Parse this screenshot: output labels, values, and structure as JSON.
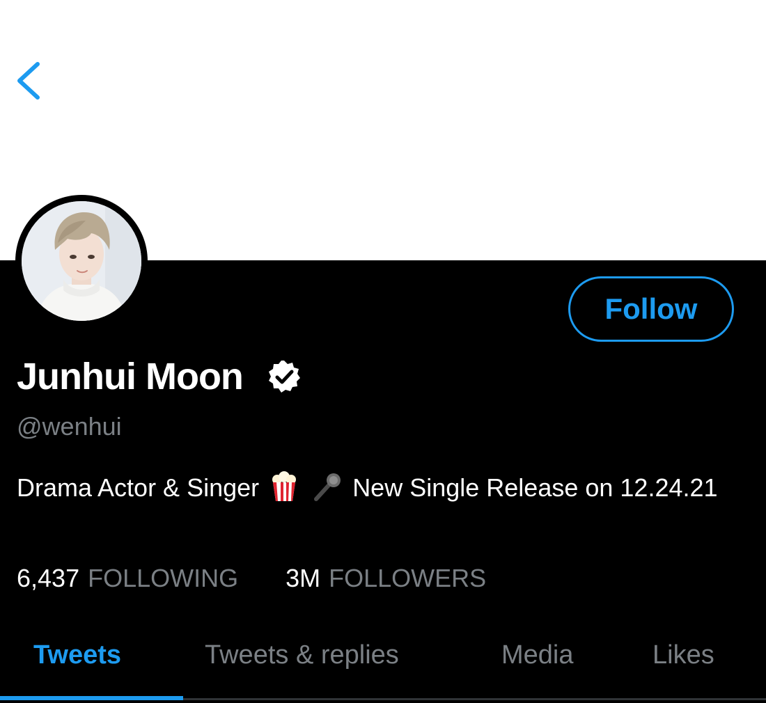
{
  "header": {
    "back_icon": "chevron-left-icon"
  },
  "profile": {
    "display_name": "Junhui Moon",
    "verified_icon": "verified-badge-icon",
    "handle": "@wenhui",
    "bio_before": "Drama Actor & Singer",
    "bio_emoji_1": "popcorn-emoji",
    "bio_emoji_2": "microphone-emoji",
    "bio_after": "New Single Release on 12.24.21",
    "follow_label": "Follow"
  },
  "stats": {
    "following_count": "6,437",
    "following_label": "FOLLOWING",
    "followers_count": "3M",
    "followers_label": "FOLLOWERS"
  },
  "tabs": [
    {
      "label": "Tweets",
      "active": true
    },
    {
      "label": "Tweets & replies",
      "active": false
    },
    {
      "label": "Media",
      "active": false
    },
    {
      "label": "Likes",
      "active": false
    }
  ],
  "colors": {
    "accent": "#1d9bf0",
    "background": "#000000",
    "muted_text": "#7b8085",
    "banner": "#ffffff"
  }
}
